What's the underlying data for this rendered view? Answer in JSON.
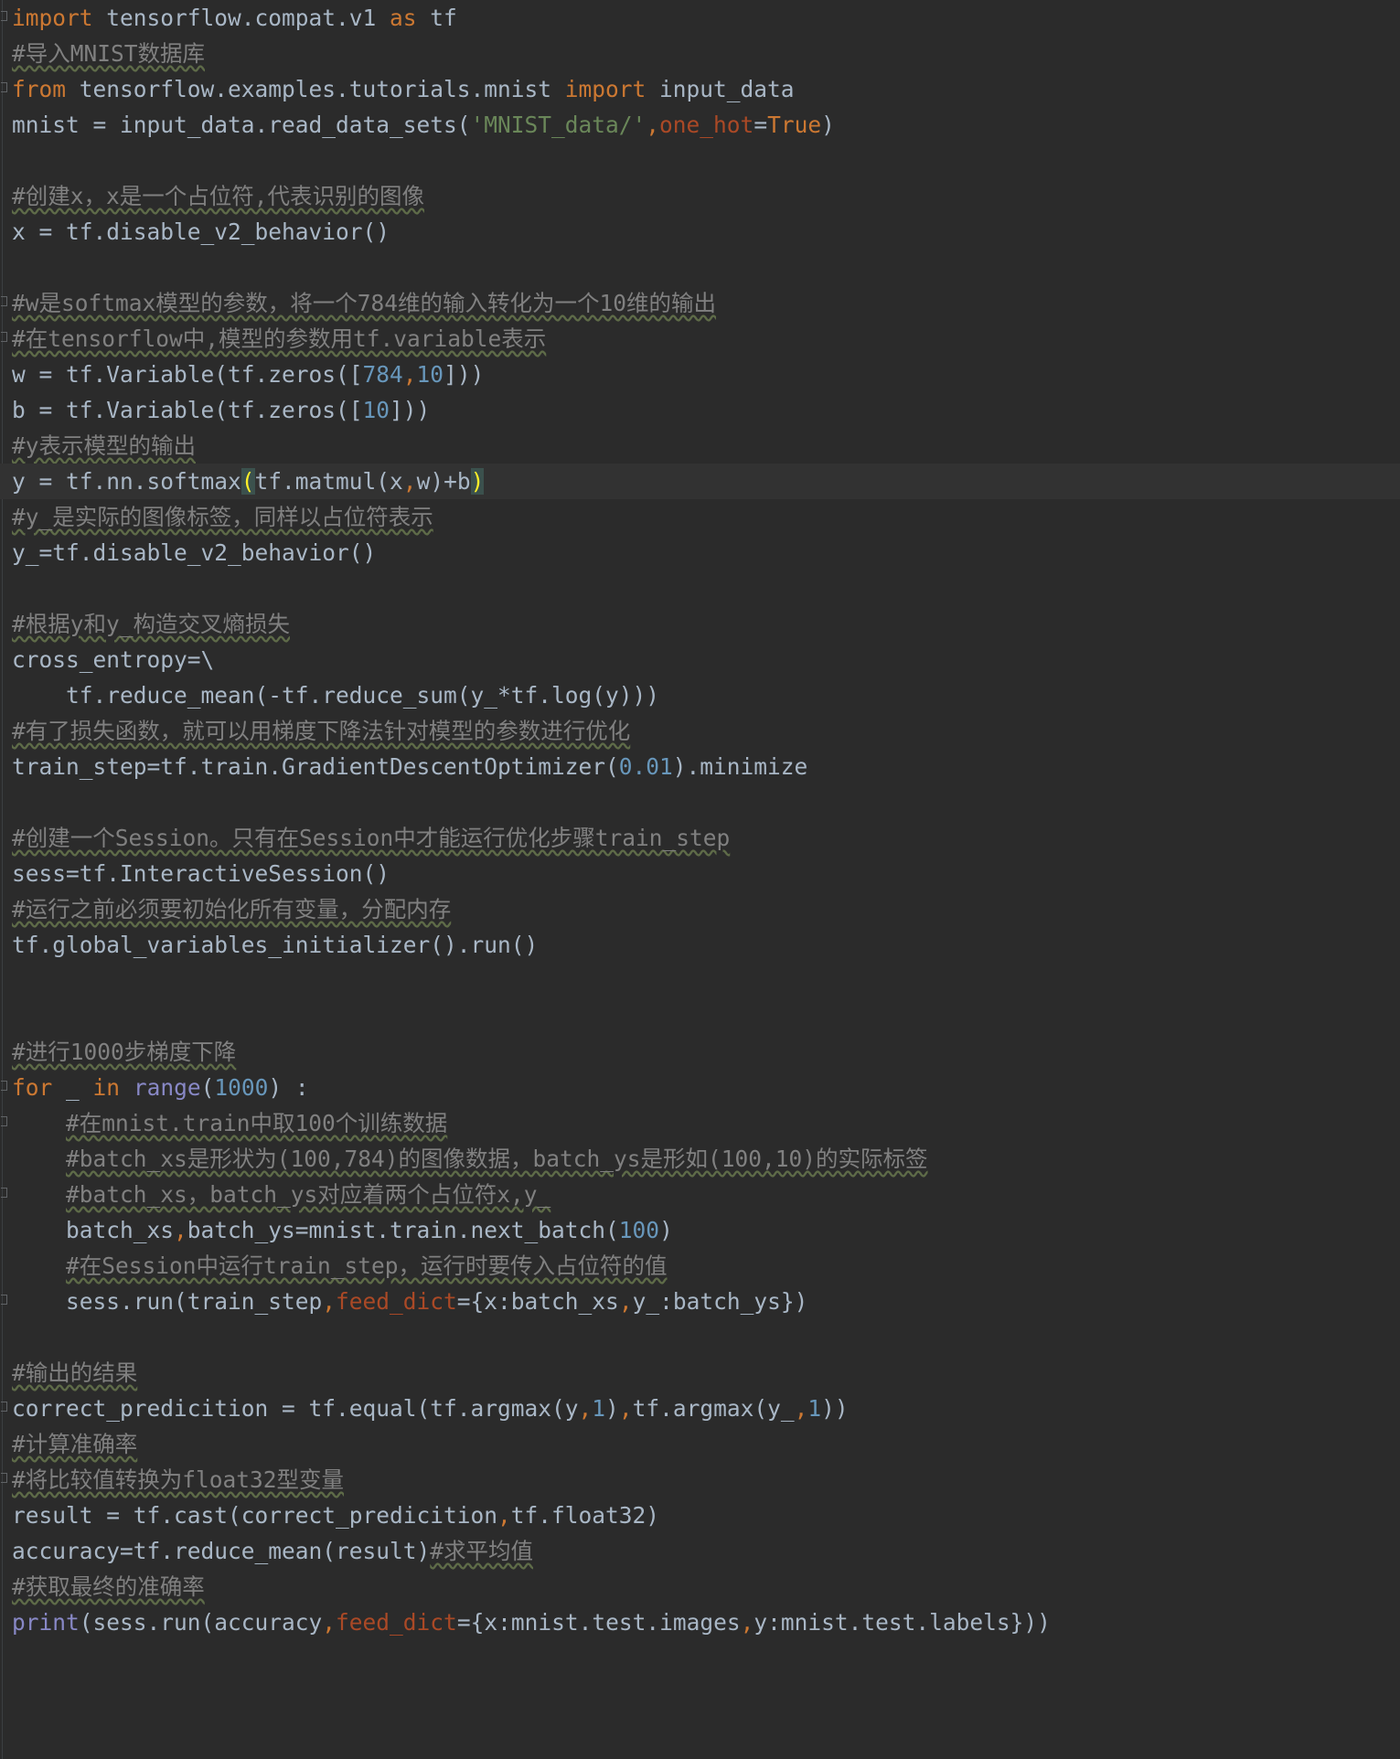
{
  "editor": {
    "language": "python",
    "current_line_index": 13,
    "colors": {
      "background": "#2b2b2b",
      "text": "#a9b7c6",
      "keyword": "#cc7832",
      "string": "#6a8759",
      "number": "#6897bb",
      "comment": "#808080",
      "named_param": "#aa4926",
      "builtin": "#8888c6",
      "bracket_match": "#ffef28"
    },
    "lines": [
      {
        "text": "import tensorflow.compat.v1 as tf"
      },
      {
        "text": "#导入MNIST数据库"
      },
      {
        "text": "from tensorflow.examples.tutorials.mnist import input_data"
      },
      {
        "text": "mnist = input_data.read_data_sets('MNIST_data/',one_hot=True)"
      },
      {
        "text": ""
      },
      {
        "text": "#创建x，x是一个占位符,代表识别的图像"
      },
      {
        "text": "x = tf.disable_v2_behavior()"
      },
      {
        "text": ""
      },
      {
        "text": "#w是softmax模型的参数，将一个784维的输入转化为一个10维的输出"
      },
      {
        "text": "#在tensorflow中,模型的参数用tf.variable表示"
      },
      {
        "text": "w = tf.Variable(tf.zeros([784,10]))"
      },
      {
        "text": "b = tf.Variable(tf.zeros([10]))"
      },
      {
        "text": "#y表示模型的输出"
      },
      {
        "text": "y = tf.nn.softmax(tf.matmul(x,w)+b)"
      },
      {
        "text": "#y_是实际的图像标签，同样以占位符表示"
      },
      {
        "text": "y_=tf.disable_v2_behavior()"
      },
      {
        "text": ""
      },
      {
        "text": "#根据y和y_构造交叉熵损失"
      },
      {
        "text": "cross_entropy=\\"
      },
      {
        "text": "    tf.reduce_mean(-tf.reduce_sum(y_*tf.log(y)))"
      },
      {
        "text": "#有了损失函数，就可以用梯度下降法针对模型的参数进行优化"
      },
      {
        "text": "train_step=tf.train.GradientDescentOptimizer(0.01).minimize"
      },
      {
        "text": ""
      },
      {
        "text": "#创建一个Session。只有在Session中才能运行优化步骤train_step"
      },
      {
        "text": "sess=tf.InteractiveSession()"
      },
      {
        "text": "#运行之前必须要初始化所有变量，分配内存"
      },
      {
        "text": "tf.global_variables_initializer().run()"
      },
      {
        "text": ""
      },
      {
        "text": ""
      },
      {
        "text": "#进行1000步梯度下降"
      },
      {
        "text": "for _ in range(1000) :"
      },
      {
        "text": "    #在mnist.train中取100个训练数据"
      },
      {
        "text": "    #batch_xs是形状为(100,784)的图像数据，batch_ys是形如(100,10)的实际标签"
      },
      {
        "text": "    #batch_xs，batch_ys对应着两个占位符x,y_"
      },
      {
        "text": "    batch_xs,batch_ys=mnist.train.next_batch(100)"
      },
      {
        "text": "    #在Session中运行train_step，运行时要传入占位符的值"
      },
      {
        "text": "    sess.run(train_step,feed_dict={x:batch_xs,y_:batch_ys})"
      },
      {
        "text": ""
      },
      {
        "text": "#输出的结果"
      },
      {
        "text": "correct_predicition = tf.equal(tf.argmax(y,1),tf.argmax(y_,1))"
      },
      {
        "text": "#计算准确率"
      },
      {
        "text": "#将比较值转换为float32型变量"
      },
      {
        "text": "result = tf.cast(correct_predicition,tf.float32)"
      },
      {
        "text": "accuracy=tf.reduce_mean(result)#求平均值"
      },
      {
        "text": "#获取最终的准确率"
      },
      {
        "text": "print(sess.run(accuracy,feed_dict={x:mnist.test.images,y:mnist.test.labels}))"
      }
    ]
  }
}
